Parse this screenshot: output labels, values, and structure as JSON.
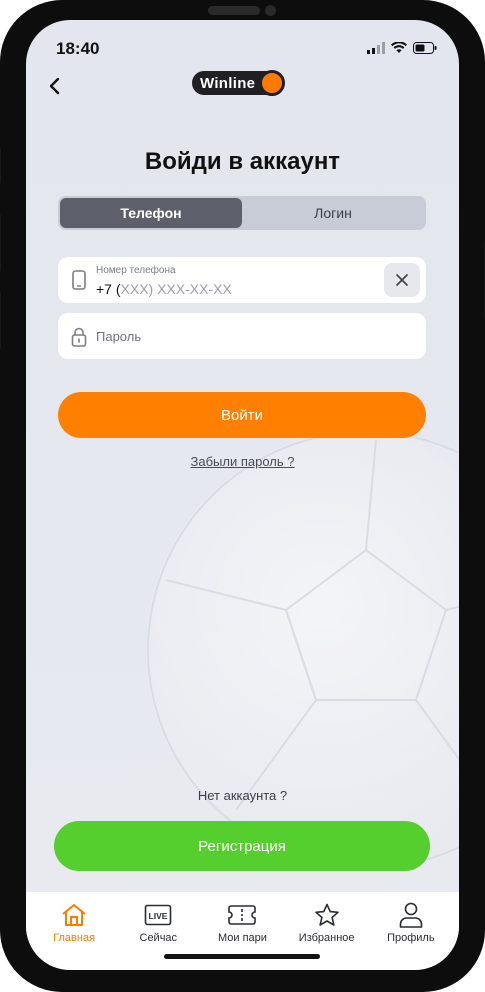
{
  "status": {
    "time": "18:40"
  },
  "header": {
    "logo_text": "Winline"
  },
  "title": "Войди в аккаунт",
  "segment": {
    "items": [
      "Телефон",
      "Логин"
    ],
    "active": 0
  },
  "phone_field": {
    "label": "Номер телефона",
    "prefix": "+7 (",
    "mask": "XXX) XXX-XX-XX"
  },
  "password_field": {
    "placeholder": "Пароль"
  },
  "login_button": "Войти",
  "forgot_link": "Забыли пароль ?",
  "no_account": "Нет аккаунта ?",
  "register_button": "Регистрация",
  "tabbar": {
    "items": [
      {
        "label": "Главная",
        "icon": "home-icon"
      },
      {
        "label": "Сейчас",
        "icon": "live-icon",
        "badge": "LIVE"
      },
      {
        "label": "Мои пари",
        "icon": "ticket-icon"
      },
      {
        "label": "Избранное",
        "icon": "star-icon"
      },
      {
        "label": "Профиль",
        "icon": "person-icon"
      }
    ],
    "active": 0
  },
  "colors": {
    "accent": "#ff8000",
    "register": "#54cf2d",
    "active_tab": "#ff7a00"
  }
}
